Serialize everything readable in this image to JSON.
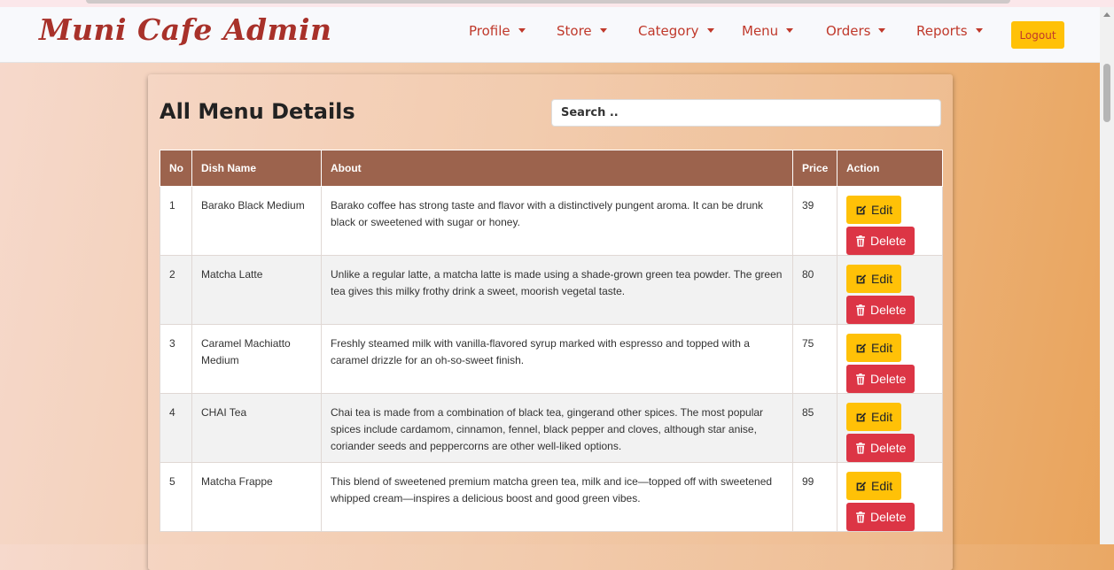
{
  "brand": "Muni Cafe Admin",
  "nav": {
    "items": [
      {
        "label": "Profile"
      },
      {
        "label": "Store"
      },
      {
        "label": "Category"
      },
      {
        "label": "Menu"
      },
      {
        "label": "Orders"
      },
      {
        "label": "Reports"
      }
    ],
    "logout": "Logout"
  },
  "page": {
    "title": "All Menu Details",
    "search_placeholder": "Search .."
  },
  "table": {
    "headers": [
      "No",
      "Dish Name",
      "About",
      "Price",
      "Action"
    ],
    "edit_label": "Edit",
    "delete_label": "Delete",
    "rows": [
      {
        "no": "1",
        "name": "Barako Black Medium",
        "about": "Barako coffee has strong taste and flavor with a distinctively pungent aroma. It can be drunk black or sweetened with sugar or honey.",
        "price": "39"
      },
      {
        "no": "2",
        "name": "Matcha Latte",
        "about": "Unlike a regular latte, a matcha latte is made using a shade-grown green tea powder. The green tea gives this milky frothy drink a sweet, moorish vegetal taste.",
        "price": "80"
      },
      {
        "no": "3",
        "name": "Caramel Machiatto Medium",
        "about": "Freshly steamed milk with vanilla-flavored syrup marked with espresso and topped with a caramel drizzle for an oh-so-sweet finish.",
        "price": "75"
      },
      {
        "no": "4",
        "name": "CHAI Tea",
        "about": "Chai tea is made from a combination of black tea, gingerand other spices. The most popular spices include cardamom, cinnamon, fennel, black pepper and cloves, although star anise, coriander seeds and peppercorns are other well-liked options.",
        "price": "85"
      },
      {
        "no": "5",
        "name": "Matcha Frappe",
        "about": "This blend of sweetened premium matcha green tea, milk and ice—topped off with sweetened whipped cream—inspires a delicious boost and good green vibes.",
        "price": "99"
      }
    ]
  },
  "icons": {
    "edit": "edit-icon",
    "delete": "trash-icon"
  },
  "colors": {
    "brand": "#a8312a",
    "nav_text": "#c0392b",
    "table_header": "#9c634d",
    "edit_button": "#ffc107",
    "delete_button": "#dc3545"
  }
}
